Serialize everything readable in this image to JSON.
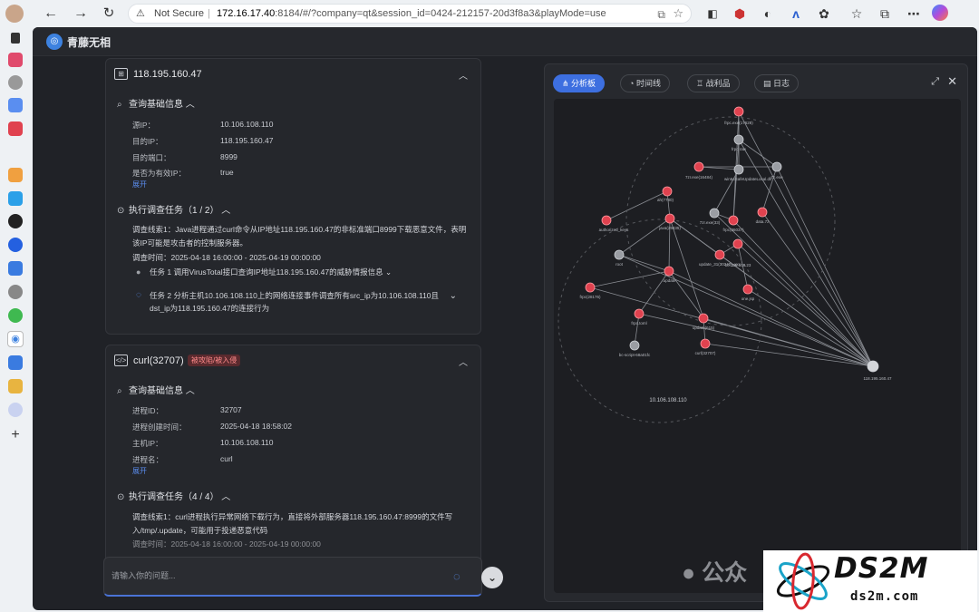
{
  "browser": {
    "security": "Not Secure",
    "url_host": "172.16.17.40",
    "url_rest": ":8184/#/?company=qt&session_id=0424-212157-20d3f8a3&playMode=use"
  },
  "app": {
    "name": "青藤无相"
  },
  "card1": {
    "title": "118.195.160.47",
    "basic_title": "查询基础信息",
    "fields": [
      {
        "label": "源IP：",
        "value": "10.106.108.110"
      },
      {
        "label": "目的IP：",
        "value": "118.195.160.47"
      },
      {
        "label": "目的端口：",
        "value": "8999"
      },
      {
        "label": "是否为有效IP：",
        "value": "true"
      }
    ],
    "expand": "展开",
    "task_title": "执行调查任务（1 / 2）",
    "clue": "调查线索1：Java进程通过curl命令从IP地址118.195.160.47的非标准端口8999下载恶意文件，表明该IP可能是攻击者的控制服务器。",
    "time": "调查时间：2025-04-18 16:00:00 - 2025-04-19 00:00:00",
    "task1": "任务 1 调用VirusTotal接口查询IP地址118.195.160.47的威胁情报信息",
    "task2": "任务 2 分析主机10.106.108.110上的网络连接事件调查所有src_ip为10.106.108.110且dst_ip为118.195.160.47的连接行为"
  },
  "card2": {
    "title": "curl(32707)",
    "badge": "被攻陷/被入侵",
    "basic_title": "查询基础信息",
    "fields": [
      {
        "label": "进程ID：",
        "value": "32707"
      },
      {
        "label": "进程创建时间：",
        "value": "2025-04-18 18:58:02"
      },
      {
        "label": "主机IP：",
        "value": "10.106.108.110"
      },
      {
        "label": "进程名：",
        "value": "curl"
      }
    ],
    "expand": "展开",
    "task_title": "执行调查任务（4 / 4）",
    "clue": "调查线索1：curl进程执行异常网络下载行为，直接将外部服务器118.195.160.47:8999的文件写入/tmp/.update，可能用于投递恶意代码",
    "time_partial": "调查时间：2025-04-18 16:00:00 - 2025-04-19 00:00:00"
  },
  "chat": {
    "placeholder": "请输入你的问题..."
  },
  "right": {
    "tabs": [
      "分析板",
      "时间线",
      "战利品",
      "日志"
    ],
    "graph_labels": {
      "frpc_exe": "frpc.exe(17628)",
      "frpc_raw": "frpc raw",
      "seven_z": "7z.exe",
      "seven_z_1": "7zr.exe(16484)",
      "win64": "win64SafeUpdateLocal.dll",
      "ah": "ah(7780)",
      "data": "data.7z",
      "auth_keys": "authorized_keys",
      "java": "java(29435)",
      "sevenzr": "7zr.exe(33)",
      "frpc_cfg": "frpc(36037)",
      "root": "root",
      "update_31": "update_31(30240)_xxx",
      "ip_23": "10.106.108.23",
      "one_jsp": "one.jsp",
      "frpc_28176": "frpc(28176)",
      "update": ".update",
      "frpc_toml": "frpc.toml",
      "update_615": "update(615)",
      "bc_script": "bc-script-68a01fc",
      "curl": "curl(32707)",
      "ip_47": "118.195.160.47",
      "ip_110": "10.106.108.110"
    }
  },
  "watermark": {
    "text": "公众",
    "brand": "DS2M",
    "site": "ds2m.com"
  },
  "colors": {
    "accent": "#3d6fe0",
    "danger": "#e0424f",
    "bg": "#202227"
  }
}
